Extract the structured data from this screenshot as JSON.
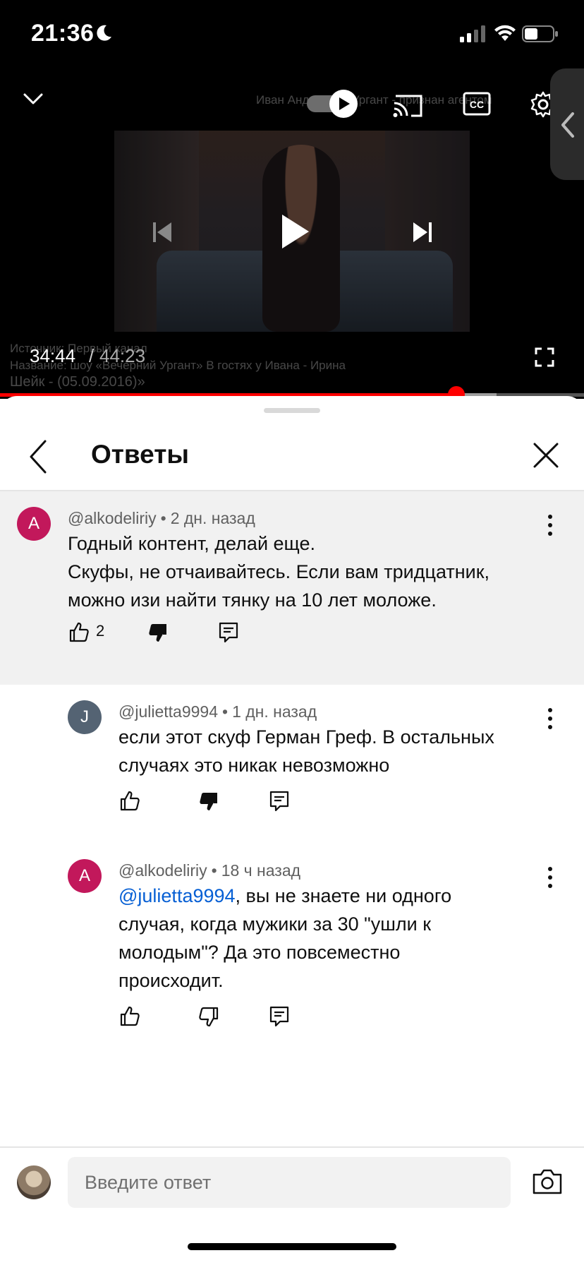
{
  "status_bar": {
    "time": "21:36"
  },
  "player": {
    "channel_overlay_text": "Иван Андреевич Ургант - признан агентом",
    "source_overlay_line1": "Источник: Первый канал",
    "source_overlay_line2": "Название: шоу «Вечерний Ургант» В гостях у Ивана - Ирина",
    "source_overlay_line3": "Шейк - (05.09.2016)»",
    "current_time": "34:44",
    "separator": "/",
    "total_time": "44:23",
    "progress": 0.781,
    "buffered": 0.85,
    "colors": {
      "progress": "#ff0000"
    }
  },
  "panel": {
    "title": "Ответы"
  },
  "comments": [
    {
      "handle": "@alkodeliriy",
      "time": "2 дн. назад",
      "avatar_letter": "A",
      "line1": "Годный контент, делай еще.",
      "line2": "Скуфы, не отчаивайтесь. Если вам тридцатник,",
      "line3": "можно изи найти тянку на 10 лет моложе.",
      "likes": "2"
    },
    {
      "handle": "@julietta9994",
      "time": "1 дн. назад",
      "avatar_letter": "J",
      "line1": "если этот скуф Герман Греф. В остальных",
      "line2": "случаях это никак невозможно"
    },
    {
      "handle": "@alkodeliriy",
      "time": "18 ч назад",
      "avatar_letter": "A",
      "mention": "@julietta9994",
      "line1_rest": ", вы не знаете ни одного",
      "line2": "случая, когда мужики за 30 \"ушли к",
      "line3": "молодым\"? Да это повсеместно",
      "line4": "происходит."
    }
  ],
  "composer": {
    "placeholder": "Введите ответ"
  },
  "colors": {
    "avatar_pink": "#c2185b",
    "avatar_slate": "#546373",
    "mention": "#065fd4"
  }
}
